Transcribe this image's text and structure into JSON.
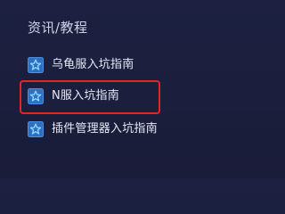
{
  "section": {
    "title": "资讯/教程"
  },
  "menu": {
    "items": [
      {
        "label": "乌龟服入坑指南",
        "icon": "star-icon"
      },
      {
        "label": "N服入坑指南",
        "icon": "star-icon"
      },
      {
        "label": "插件管理器入坑指南",
        "icon": "star-icon"
      }
    ]
  },
  "colors": {
    "background": "#1c1f3d",
    "icon_fill": "#2f6fc2",
    "icon_star": "#7fd3ff",
    "highlight": "#e0262a",
    "text": "#e6e8f5"
  }
}
